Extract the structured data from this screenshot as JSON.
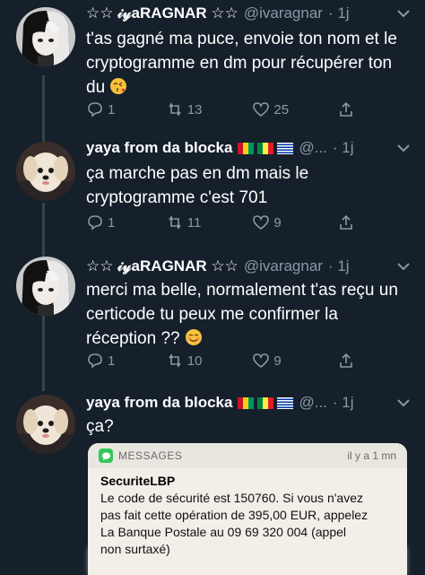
{
  "theme": {
    "background": "#15202b",
    "text": "#ffffff",
    "muted": "#8899a6",
    "thread_line": "#38444d"
  },
  "tweets": [
    {
      "author": "☆☆ 𝒾𝓎aRAGNAR ☆☆",
      "handle": "@ivaragnar",
      "time": "· 1j",
      "avatar": "anime-girl-black-white-hair",
      "text": "t'as gagné ma puce, envoie ton nom et le cryptogramme en dm pour récupérer ton du",
      "emoji": "face-blowing-kiss",
      "replies": "1",
      "retweets": "13",
      "likes": "25"
    },
    {
      "author": "yaya from da blocka",
      "handle": "@...",
      "time": "· 1j",
      "avatar": "white-fluffy-dog",
      "flags": [
        "guinea-flag",
        "senegal-flag",
        "uruguay-flag"
      ],
      "text": "ça marche pas en dm mais le cryptogramme c'est 701",
      "replies": "1",
      "retweets": "11",
      "likes": "9"
    },
    {
      "author": "☆☆ 𝒾𝓎aRAGNAR ☆☆",
      "handle": "@ivaragnar",
      "time": "· 1j",
      "avatar": "anime-girl-black-white-hair",
      "text": "merci ma belle, normalement t'as reçu un certicode tu peux me confirmer la réception ??",
      "emoji": "smiling-face",
      "replies": "1",
      "retweets": "10",
      "likes": "9"
    },
    {
      "author": "yaya from da blocka",
      "handle": "@...",
      "time": "· 1j",
      "avatar": "white-fluffy-dog",
      "flags": [
        "guinea-flag",
        "senegal-flag",
        "uruguay-flag"
      ],
      "text": "ça?"
    }
  ],
  "notification": {
    "app": "MESSAGES",
    "time": "il y a 1 mn",
    "sender": "SecuriteLBP",
    "lines": [
      "Le code de sécurité est 150760. Si vous n'avez",
      "pas fait cette opération de 395,00 EUR, appelez",
      "La Banque Postale au 09 69 320 004 (appel",
      "non surtaxé)"
    ]
  }
}
